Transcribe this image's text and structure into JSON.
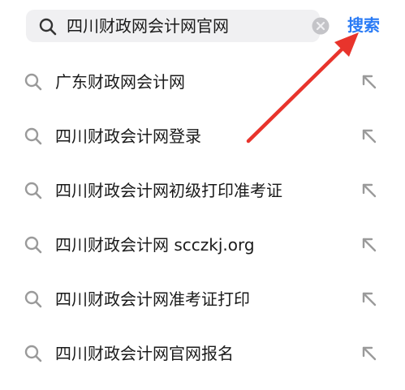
{
  "search": {
    "query": "四川财政网会计网官网",
    "submit_label": "搜索",
    "icon": "search-icon",
    "clear_icon": "clear-icon"
  },
  "suggestions": [
    {
      "label": "广东财政网会计网"
    },
    {
      "label": "四川财政会计网登录"
    },
    {
      "label": "四川财政会计网初级打印准考证"
    },
    {
      "label": "四川财政会计网 scczkj.org"
    },
    {
      "label": "四川财政会计网准考证打印"
    },
    {
      "label": "四川财政会计网官网报名"
    }
  ],
  "colors": {
    "accent": "#2a7bf5",
    "annotation_arrow": "#e8342c",
    "search_bg": "#f0f0f2",
    "icon_gray": "#9a9a9a"
  }
}
